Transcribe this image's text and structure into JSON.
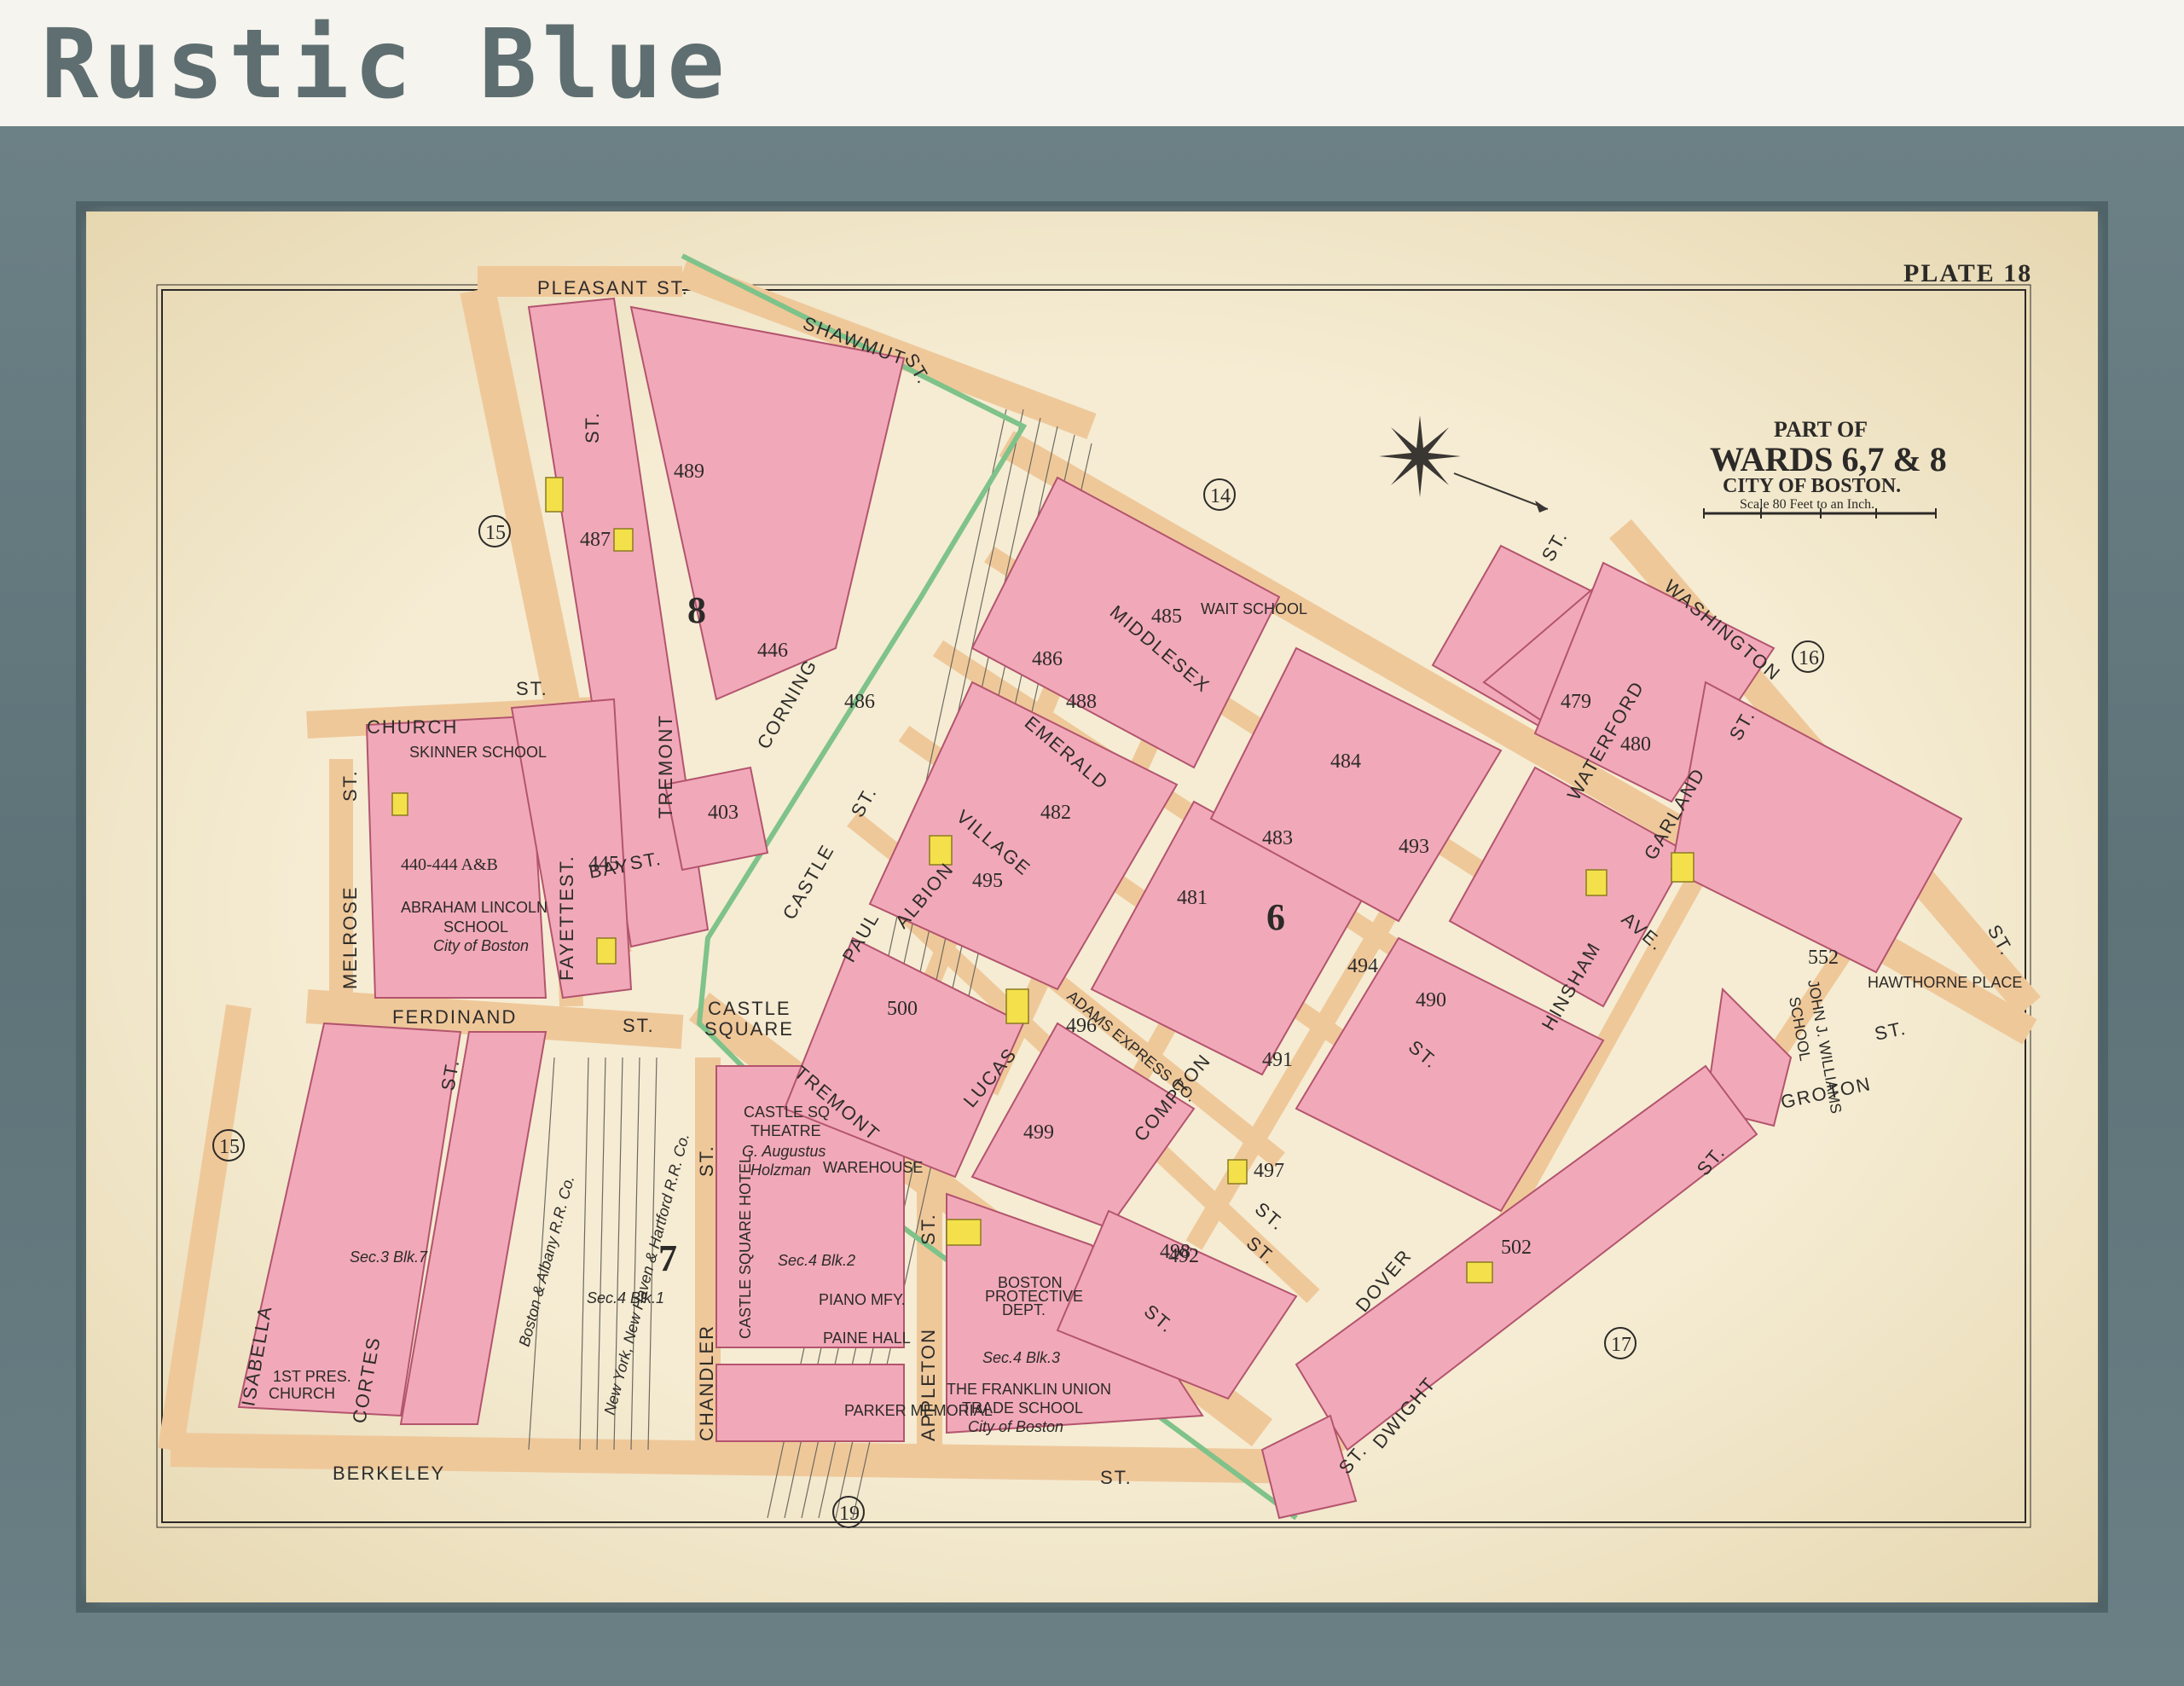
{
  "page": {
    "title": "Rustic Blue"
  },
  "map": {
    "plate": "PLATE 18",
    "heading": {
      "line1": "PART OF",
      "line2": "WARDS 6,7 & 8",
      "line3": "CITY OF BOSTON.",
      "scale": "Scale 80 Feet to an Inch."
    },
    "wards": [
      {
        "id": "w15a",
        "label": "15"
      },
      {
        "id": "w15b",
        "label": "15"
      },
      {
        "id": "w14",
        "label": "14"
      },
      {
        "id": "w16",
        "label": "16"
      },
      {
        "id": "w17",
        "label": "17"
      },
      {
        "id": "w19",
        "label": "19"
      },
      {
        "id": "w8",
        "label": "8"
      },
      {
        "id": "w6",
        "label": "6"
      },
      {
        "id": "w7",
        "label": "7"
      }
    ],
    "streets": {
      "pleasant": "PLEASANT",
      "st_pleasant": "ST.",
      "shawmut": "SHAWMUT",
      "st_shawmut": "ST.",
      "church": "CHURCH",
      "st_church": "ST.",
      "melrose": "MELROSE",
      "st_melrose": "ST.",
      "fayette": "FAYETTE",
      "st_fayette": "ST.",
      "tremont_n": "TREMONT",
      "st_tremont_n": "ST.",
      "corning": "CORNING",
      "ferdinand": "FERDINAND",
      "st_ferdinand": "ST.",
      "isabella": "ISABELLA",
      "cortes": "CORTES",
      "st_cortes": "ST.",
      "chandler": "CHANDLER",
      "st_chandler": "ST.",
      "appleton": "APPLETON",
      "st_appleton": "ST.",
      "berkeley": "BERKELEY",
      "st_berkeley": "ST.",
      "castle": "CASTLE",
      "st_castle": "ST.",
      "paul": "PAUL",
      "albion": "ALBION",
      "village": "VILLAGE",
      "emerald": "EMERALD",
      "middlesex": "MIDDLESEX",
      "tremont_s": "TREMONT",
      "st_tremont_s": "ST.",
      "lucas": "LUCAS",
      "compton": "COMPTON",
      "st_compton": "ST.",
      "dover": "DOVER",
      "st_dover": "ST.",
      "dwight": "DWIGHT",
      "st_dwight": "ST.",
      "hinsham": "HINSHAM",
      "waterford": "WATERFORD",
      "garland": "GARLAND",
      "st_garland": "ST.",
      "washington": "WASHINGTON",
      "st_washington": "ST.",
      "ave": "AVE.",
      "groton": "GROTON",
      "st_groton": "ST.",
      "st_east": "ST.",
      "castle_square_1": "CASTLE",
      "castle_square_2": "SQUARE",
      "bay": "BAY",
      "st_bay": "ST.",
      "st_middle": "ST.",
      "st_lower": "ST."
    },
    "buildings": {
      "lincoln_1": "ABRAHAM LINCOLN",
      "lincoln_2": "SCHOOL",
      "lincoln_3": "City of Boston",
      "castle_sq_1": "CASTLE SQ",
      "castle_sq_2": "THEATRE",
      "castle_sq_3": "G. Augustus",
      "castle_sq_4": "Holzman",
      "castle_hotel": "CASTLE SQUARE HOTEL",
      "warehouse": "WAREHOUSE",
      "piano": "PIANO MFY.",
      "paine": "PAINE HALL",
      "parker": "PARKER MEMORIAL",
      "franklin_1": "THE FRANKLIN UNION",
      "franklin_2": "TRADE SCHOOL",
      "franklin_3": "City of Boston",
      "adams_1": "ADAMS EXPRESS CO.",
      "williams_1": "JOHN J. WILLIAMS",
      "williams_2": "SCHOOL",
      "wait": "WAIT SCHOOL",
      "church_pres_1": "1ST PRES.",
      "church_pres_2": "CHURCH",
      "protective_1": "BOSTON",
      "protective_2": "PROTECTIVE",
      "protective_3": "DEPT.",
      "skinner": "SKINNER SCHOOL",
      "rr_1": "Boston & Albany R.R. Co.",
      "rr_2": "New York, New Haven & Hartford R.R. Co.",
      "sec_blk1": "Sec.4 Blk.1",
      "sec_blk2": "Sec.4 Blk.2",
      "sec_blk3": "Sec.4 Blk.3",
      "sec_blk7": "Sec.3 Blk.7",
      "hawthorne": "HAWTHORNE PLACE"
    },
    "block_numbers": [
      "489",
      "487",
      "486",
      "488",
      "485",
      "486",
      "484",
      "483",
      "482",
      "481",
      "480",
      "479",
      "495",
      "494",
      "493",
      "492",
      "491",
      "500",
      "499",
      "497",
      "498",
      "496",
      "502",
      "490",
      "552",
      "440-444 A&B",
      "445",
      "446",
      "403"
    ]
  }
}
